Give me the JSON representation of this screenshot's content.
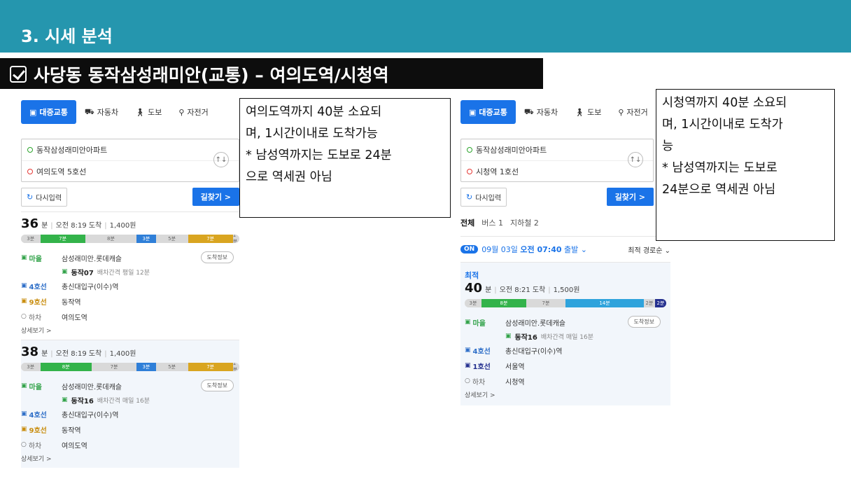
{
  "slide": {
    "section_title": "3. 시세 분석",
    "sub_title": "사당동 동작삼성래미안(교통) – 여의도역/시청역"
  },
  "colors": {
    "header": "#2596ae",
    "accent": "#1a73e8",
    "green_line": "#33b34a",
    "line4": "#2f7fd8",
    "line9": "#d9a520",
    "line1": "#24308f"
  },
  "modes": [
    "대중교통",
    "자동차",
    "도보",
    "자전거"
  ],
  "mode_icons": [
    "bus-icon",
    "car-icon",
    "walk-icon",
    "bike-icon"
  ],
  "common": {
    "reset_label": "다시입력",
    "search_label": "길찾기 >",
    "more_label": "상세보기 >",
    "info_label": "도착정보",
    "unit_min": "분"
  },
  "left": {
    "origin": "동작삼성래미안아파트",
    "destination": "여의도역 5호선",
    "results": [
      {
        "minutes": "36",
        "arrival": "오전 8:19 도착",
        "fare": "1,400원",
        "bar": [
          {
            "label": "3분",
            "kind": "walk",
            "minutes": 3
          },
          {
            "label": "7분",
            "kind": "green",
            "minutes": 7
          },
          {
            "label": "8분",
            "kind": "walk",
            "minutes": 8
          },
          {
            "label": "3분",
            "kind": "blue",
            "minutes": 3
          },
          {
            "label": "5분",
            "kind": "walk",
            "minutes": 5
          },
          {
            "label": "7분",
            "kind": "yellow",
            "minutes": 7
          },
          {
            "label": "1분",
            "kind": "walk",
            "minutes": 1
          }
        ],
        "steps": [
          {
            "label": "마을",
            "color": "green",
            "name": "삼성래미안.롯데캐슬",
            "has_info": true
          },
          {
            "label": "4호선",
            "color": "blue",
            "name": "총신대입구(이수)역"
          },
          {
            "label": "9호선",
            "color": "yellow",
            "name": "동작역"
          },
          {
            "label": "하차",
            "color": "gray",
            "name": "여의도역"
          }
        ],
        "bus": {
          "number": "동작07",
          "interval": "배차간격 평일 12분"
        }
      },
      {
        "minutes": "38",
        "arrival": "오전 8:19 도착",
        "fare": "1,400원",
        "bar": [
          {
            "label": "3분",
            "kind": "walk",
            "minutes": 3
          },
          {
            "label": "8분",
            "kind": "green",
            "minutes": 8
          },
          {
            "label": "7분",
            "kind": "walk",
            "minutes": 7
          },
          {
            "label": "3분",
            "kind": "blue",
            "minutes": 3
          },
          {
            "label": "5분",
            "kind": "walk",
            "minutes": 5
          },
          {
            "label": "7분",
            "kind": "yellow",
            "minutes": 7
          },
          {
            "label": "1분",
            "kind": "walk",
            "minutes": 1
          }
        ],
        "steps": [
          {
            "label": "마을",
            "color": "green",
            "name": "삼성래미안.롯데캐슬",
            "has_info": true
          },
          {
            "label": "4호선",
            "color": "blue",
            "name": "총신대입구(이수)역"
          },
          {
            "label": "9호선",
            "color": "yellow",
            "name": "동작역"
          },
          {
            "label": "하차",
            "color": "gray",
            "name": "여의도역"
          }
        ],
        "bus": {
          "number": "동작16",
          "interval": "배차간격 매일 16분"
        }
      }
    ]
  },
  "right": {
    "origin": "동작삼성래미안아파트",
    "destination": "시청역 1호선",
    "tabs": [
      "전체",
      "버스 1",
      "지하철 2"
    ],
    "depart": {
      "badge": "ON",
      "date": "09월 03일",
      "time": "오전 07:40",
      "suffix": "출발",
      "sort": "최적 경로순"
    },
    "best_label": "최적",
    "result": {
      "minutes": "40",
      "arrival": "오전 8:21 도착",
      "fare": "1,500원",
      "bar": [
        {
          "label": "3분",
          "kind": "walk",
          "minutes": 3
        },
        {
          "label": "8분",
          "kind": "green",
          "minutes": 8
        },
        {
          "label": "7분",
          "kind": "walk",
          "minutes": 7
        },
        {
          "label": "14분",
          "kind": "sky",
          "minutes": 14
        },
        {
          "label": "2분",
          "kind": "walk",
          "minutes": 2
        },
        {
          "label": "2분",
          "kind": "navy",
          "minutes": 2
        }
      ],
      "steps": [
        {
          "label": "마을",
          "color": "green",
          "name": "삼성래미안.롯데캐슬",
          "has_info": true
        },
        {
          "label": "4호선",
          "color": "blue",
          "name": "총신대입구(이수)역"
        },
        {
          "label": "1호선",
          "color": "navy",
          "name": "서울역"
        },
        {
          "label": "하차",
          "color": "gray",
          "name": "시청역"
        }
      ],
      "bus": {
        "number": "동작16",
        "interval": "배차간격 매일 16분"
      }
    }
  },
  "notes": {
    "left": [
      "여의도역까지 40분 소요되",
      "며, 1시간이내로 도착가능",
      "* 남성역까지는 도보로 24분",
      "으로 역세권 아님"
    ],
    "right": [
      "시청역까지 40분 소요되",
      "며, 1시간이내로 도착가",
      "능",
      "* 남성역까지는 도보로",
      "24분으로 역세권 아님"
    ]
  }
}
